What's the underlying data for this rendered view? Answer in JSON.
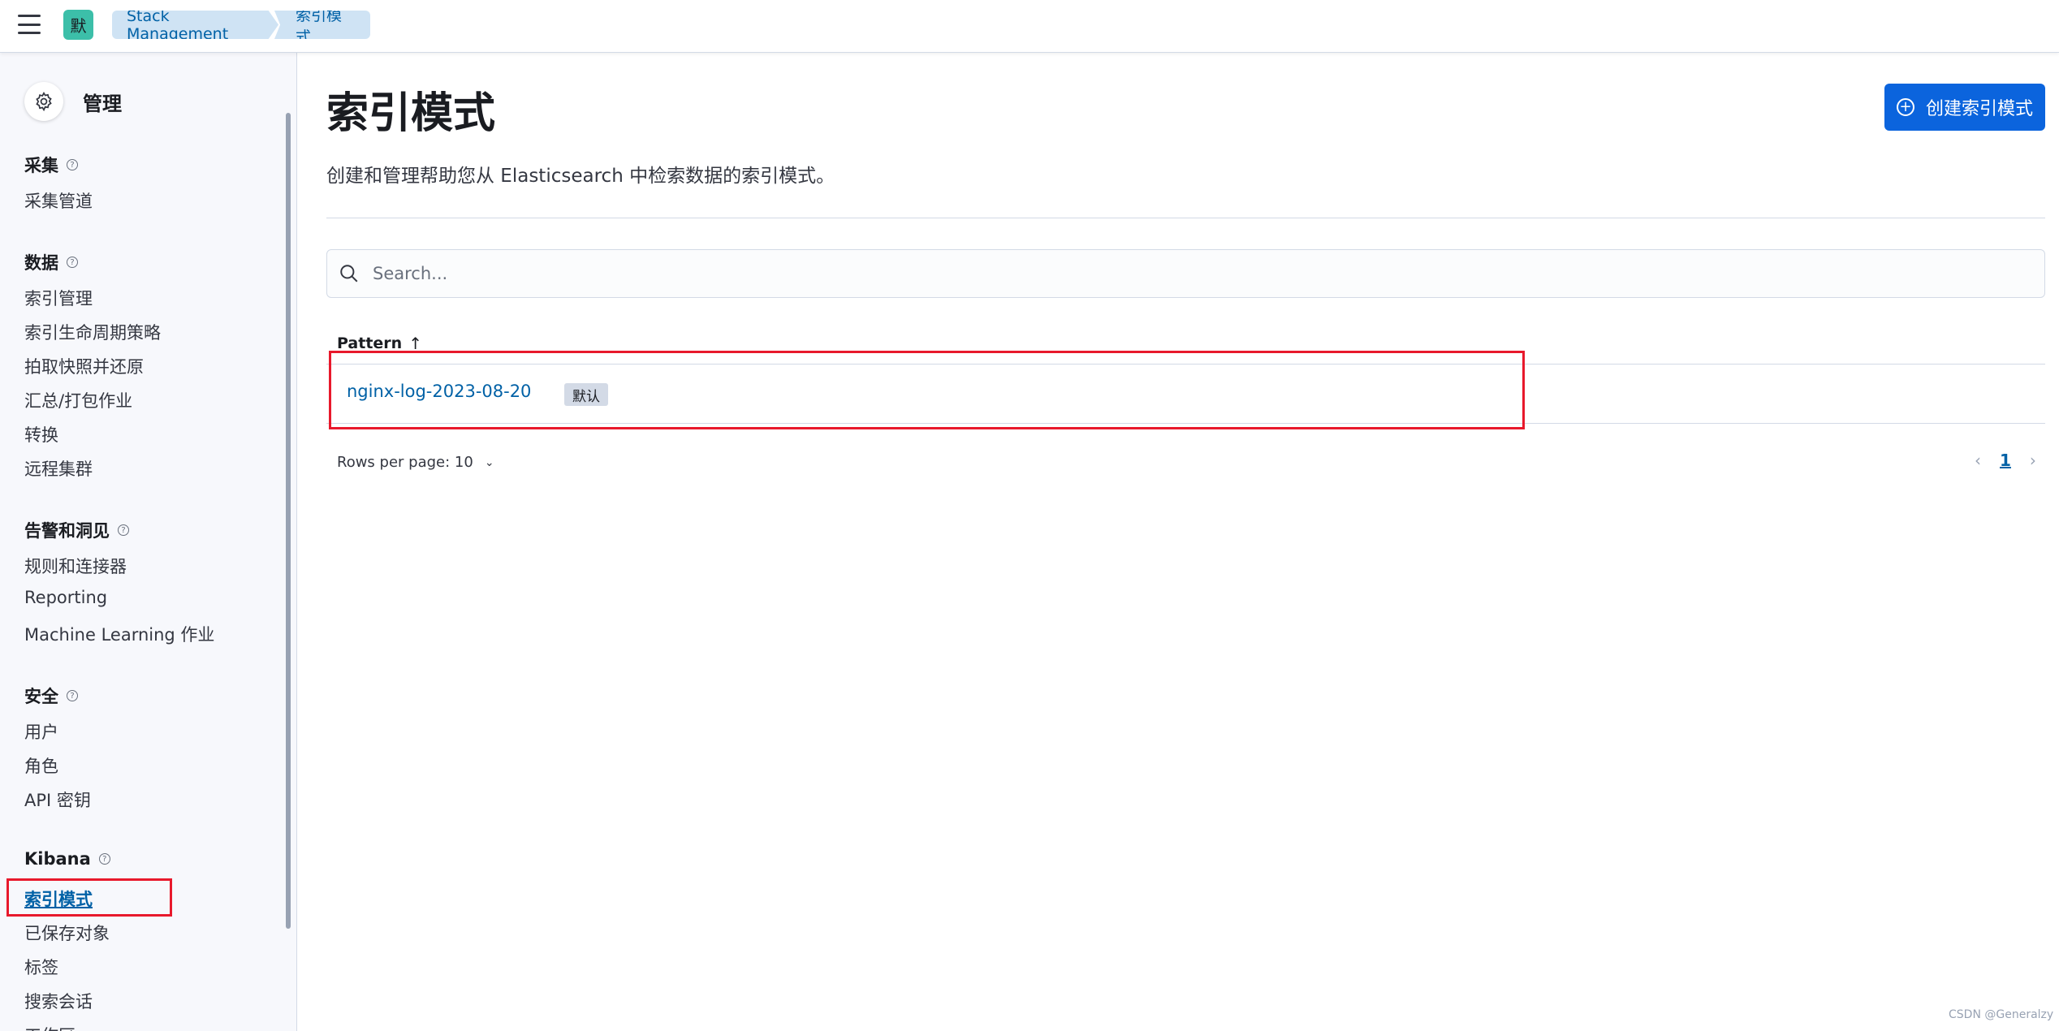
{
  "header": {
    "space_initial": "默",
    "breadcrumbs": [
      "Stack Management",
      "索引模式"
    ]
  },
  "sidebar": {
    "title": "管理",
    "groups": [
      {
        "title": "采集",
        "items": [
          "采集管道"
        ]
      },
      {
        "title": "数据",
        "items": [
          "索引管理",
          "索引生命周期策略",
          "拍取快照并还原",
          "汇总/打包作业",
          "转换",
          "远程集群"
        ]
      },
      {
        "title": "告警和洞见",
        "items": [
          "规则和连接器",
          "Reporting",
          "Machine Learning 作业"
        ]
      },
      {
        "title": "安全",
        "items": [
          "用户",
          "角色",
          "API 密钥"
        ]
      },
      {
        "title": "Kibana",
        "items": [
          "索引模式",
          "已保存对象",
          "标签",
          "搜索会话",
          "工作区"
        ]
      }
    ],
    "active_item": "索引模式"
  },
  "main": {
    "title": "索引模式",
    "create_button": "创建索引模式",
    "description": "创建和管理帮助您从 Elasticsearch 中检索数据的索引模式。",
    "search_placeholder": "Search...",
    "table": {
      "column_header": "Pattern",
      "sort_indicator": "↑",
      "rows": [
        {
          "pattern": "nginx-log-2023-08-20",
          "badge": "默认"
        }
      ]
    },
    "pagination": {
      "rows_per_page": "Rows per page: 10",
      "current_page": "1"
    }
  },
  "watermark": "CSDN @Generalzy",
  "colors": {
    "primary": "#0b64dd",
    "link": "#0061a6",
    "highlight": "#e8192c",
    "space_avatar": "#3cbfa9"
  }
}
